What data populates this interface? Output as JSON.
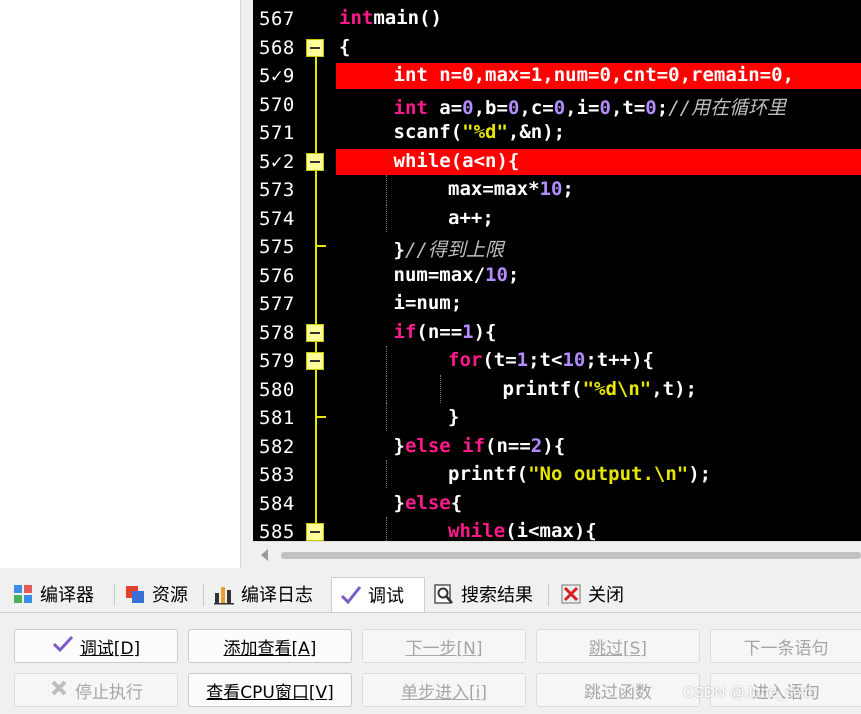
{
  "editor": {
    "lines": [
      {
        "num": "567",
        "indent": 0,
        "tokens": [
          [
            "kw",
            "int"
          ],
          [
            "",
            "main()"
          ]
        ],
        "fold": "none",
        "bp": false
      },
      {
        "num": "568",
        "indent": 0,
        "tokens": [
          [
            "",
            "{"
          ]
        ],
        "fold": "box",
        "bp": false
      },
      {
        "num": "5✓9",
        "indent": 1,
        "tokens": [
          [
            "kw",
            "int"
          ],
          [
            "",
            " n="
          ],
          [
            "num",
            "0"
          ],
          [
            "",
            ",max="
          ],
          [
            "num",
            "1"
          ],
          [
            "",
            ",num="
          ],
          [
            "num",
            "0"
          ],
          [
            "",
            ",cnt="
          ],
          [
            "num",
            "0"
          ],
          [
            "",
            ",remain="
          ],
          [
            "num",
            "0"
          ],
          [
            "",
            ","
          ]
        ],
        "fold": "none",
        "bp": true
      },
      {
        "num": "570",
        "indent": 1,
        "tokens": [
          [
            "kw",
            "int"
          ],
          [
            "",
            " a="
          ],
          [
            "num",
            "0"
          ],
          [
            "",
            ",b="
          ],
          [
            "num",
            "0"
          ],
          [
            "",
            ",c="
          ],
          [
            "num",
            "0"
          ],
          [
            "",
            ",i="
          ],
          [
            "num",
            "0"
          ],
          [
            "",
            ",t="
          ],
          [
            "num",
            "0"
          ],
          [
            "",
            ";"
          ],
          [
            "cmt",
            "//用在循环里"
          ]
        ],
        "fold": "none",
        "bp": false
      },
      {
        "num": "571",
        "indent": 1,
        "tokens": [
          [
            "",
            "scanf("
          ],
          [
            "str",
            "\"%d\""
          ],
          [
            "",
            ",&n);"
          ]
        ],
        "fold": "none",
        "bp": false
      },
      {
        "num": "5✓2",
        "indent": 1,
        "tokens": [
          [
            "kw",
            "while"
          ],
          [
            "",
            "(a<n){"
          ]
        ],
        "fold": "box",
        "bp": true
      },
      {
        "num": "573",
        "indent": 2,
        "tokens": [
          [
            "",
            "max=max*"
          ],
          [
            "num",
            "10"
          ],
          [
            "",
            ";"
          ]
        ],
        "fold": "none",
        "bp": false
      },
      {
        "num": "574",
        "indent": 2,
        "tokens": [
          [
            "",
            "a++;"
          ]
        ],
        "fold": "none",
        "bp": false
      },
      {
        "num": "575",
        "indent": 1,
        "tokens": [
          [
            "",
            "}"
          ],
          [
            "cmt",
            "//得到上限"
          ]
        ],
        "fold": "end",
        "bp": false
      },
      {
        "num": "576",
        "indent": 1,
        "tokens": [
          [
            "",
            "num=max/"
          ],
          [
            "num",
            "10"
          ],
          [
            "",
            ";"
          ]
        ],
        "fold": "none",
        "bp": false
      },
      {
        "num": "577",
        "indent": 1,
        "tokens": [
          [
            "",
            "i=num;"
          ]
        ],
        "fold": "none",
        "bp": false
      },
      {
        "num": "578",
        "indent": 1,
        "tokens": [
          [
            "kw",
            "if"
          ],
          [
            "",
            "(n=="
          ],
          [
            "num",
            "1"
          ],
          [
            "",
            "){"
          ]
        ],
        "fold": "box",
        "bp": false
      },
      {
        "num": "579",
        "indent": 2,
        "tokens": [
          [
            "kw",
            "for"
          ],
          [
            "",
            "(t="
          ],
          [
            "num",
            "1"
          ],
          [
            "",
            ";t<"
          ],
          [
            "num",
            "10"
          ],
          [
            "",
            ";t++){"
          ]
        ],
        "fold": "box",
        "bp": false
      },
      {
        "num": "580",
        "indent": 3,
        "tokens": [
          [
            "",
            "printf("
          ],
          [
            "str",
            "\"%d\\n\""
          ],
          [
            "",
            ",t);"
          ]
        ],
        "fold": "none",
        "bp": false
      },
      {
        "num": "581",
        "indent": 2,
        "tokens": [
          [
            "",
            "}"
          ]
        ],
        "fold": "end",
        "bp": false
      },
      {
        "num": "582",
        "indent": 1,
        "tokens": [
          [
            "",
            "}"
          ],
          [
            "kw",
            "else if"
          ],
          [
            "",
            "(n=="
          ],
          [
            "num",
            "2"
          ],
          [
            "",
            "){"
          ]
        ],
        "fold": "none",
        "bp": false
      },
      {
        "num": "583",
        "indent": 2,
        "tokens": [
          [
            "",
            "printf("
          ],
          [
            "str",
            "\"No output.\\n\""
          ],
          [
            "",
            ");"
          ]
        ],
        "fold": "none",
        "bp": false
      },
      {
        "num": "584",
        "indent": 1,
        "tokens": [
          [
            "",
            "}"
          ],
          [
            "kw",
            "else"
          ],
          [
            "",
            "{"
          ]
        ],
        "fold": "none",
        "bp": false
      },
      {
        "num": "585",
        "indent": 2,
        "tokens": [
          [
            "kw",
            "while"
          ],
          [
            "",
            "(i<max){"
          ]
        ],
        "fold": "box",
        "bp": false
      }
    ]
  },
  "tabs": [
    {
      "label": "编译器",
      "icon": "compiler-grid-icon",
      "active": false
    },
    {
      "label": "资源",
      "icon": "resources-icon",
      "active": false
    },
    {
      "label": "编译日志",
      "icon": "compile-log-chart-icon",
      "active": false
    },
    {
      "label": "调试",
      "icon": "debug-check-icon",
      "active": true
    },
    {
      "label": "搜索结果",
      "icon": "search-results-icon",
      "active": false
    },
    {
      "label": "关闭",
      "icon": "close-icon",
      "active": false
    }
  ],
  "buttons": {
    "debug": "调试[D]",
    "add_watch": "添加查看[A]",
    "next_step": "下一步[N]",
    "skip": "跳过[S]",
    "next_statement": "下一条语句",
    "stop": "停止执行",
    "view_cpu": "查看CPU窗口[V]",
    "step_into": "单步进入[i]",
    "skip_function": "跳过函数",
    "enter_statement": "进入语句"
  },
  "watermark": "CSDN @June_sixth",
  "colors": {
    "breakpoint": "#ff0000",
    "keyword": "#ff1a8c",
    "number": "#b38cff",
    "string": "#e6e600",
    "fold_marker": "#ffff9a"
  }
}
